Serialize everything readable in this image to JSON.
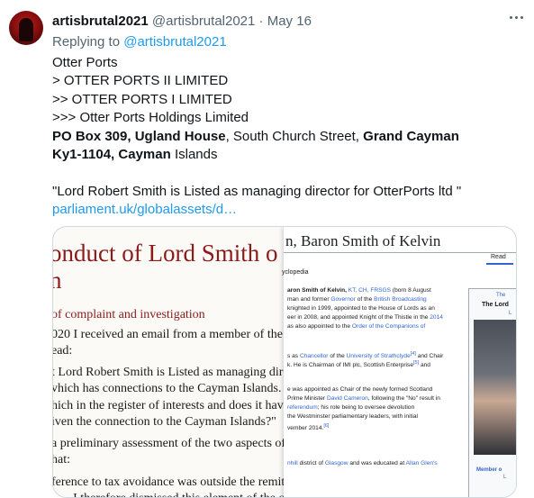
{
  "tweet": {
    "display_name": "artisbrutal2021",
    "handle": "@artisbrutal2021",
    "separator": "·",
    "date": "May 16",
    "replying_prefix": "Replying to",
    "replying_handle": "@artisbrutal2021",
    "lines": {
      "l1": "Otter Ports",
      "l2": "> OTTER PORTS II LIMITED",
      "l3": ">> OTTER PORTS I LIMITED",
      "l4": ">>> Otter Ports Holdings Limited",
      "l5a": "PO Box 309,",
      "l5b": "Ugland House",
      "l5c": ", South Church Street,",
      "l5d": "Grand Cayman",
      "l6a": "Ky1-1104,",
      "l6b": "Cayman",
      "l6c": "Islands",
      "quote": "\"Lord Robert Smith is Listed as managing director for OtterPorts ltd \"",
      "link": "parliament.uk/globalassets/d…"
    }
  },
  "media": {
    "paper": {
      "title_line1": "onduct of Lord Smith o",
      "title_line2": "n",
      "section": "of complaint and investigation",
      "p1": "020 I received an email from a member of the public",
      "p2": "ead:",
      "p3": "t Lord Robert Smith is Listed as managing direct",
      "p4": "vhich has connections to the Cayman Islands.",
      "p5": "hich in the register of interests and does it have any ta",
      "p6": "iven the connection to the Cayman Islands?\"",
      "p7": "a preliminary assessment of the two aspects of th",
      "p8": "hat:",
      "p9": "ference to tax avoidance was outside the remit o",
      "p10": "ct—I therefore dismissed this element of the com"
    },
    "wiki": {
      "title": "n, Baron Smith of Kelvin",
      "read": "Read",
      "encyclopedia": "yclopedia",
      "l1a": "aron Smith of Kelvin,",
      "l1b": "KT, CH, FRSGS",
      "l1c": "(born 8 August",
      "l2a": "man and former",
      "l2b": "Governor",
      "l2c": "of the",
      "l2d": "British Broadcasting",
      "l3": "knighted in 1999, appointed to the House of Lords as an",
      "l4a": "eer in 2008, and appointed Knight of the Thistle in the",
      "l4b": "2014",
      "l5a": "as also appointed to the",
      "l5b": "Order of the Companions of",
      "l6a": "s as",
      "l6b": "Chancellor",
      "l6c": "of the",
      "l6d": "University of Strathclyde",
      "l6e": "[4]",
      "l6f": "and Chair",
      "l7a": "k. He is Chairman of IMI plc, Scottish Enterprise",
      "l7b": "[5]",
      "l7c": "and",
      "l8": "e was appointed as Chair of the newly formed Scotland",
      "l9a": "Prime Minister",
      "l9b": "David Cameron",
      "l9c": ", following the \"No\" result in",
      "l10a": "referendum",
      "l10b": "; his role being to oversee devolution",
      "l11": "the Westminster parliamentary leaders, with initial",
      "l12a": "vember 2014.",
      "l12b": "[6]",
      "l13a": "nhill",
      "l13b": "district of",
      "l13c": "Glasgow",
      "l13d": "and was educated at",
      "l13e": "Allan Glen's",
      "info_t1": "The",
      "info_t2": "The Lord",
      "info_t3": "L",
      "info_cap": "Member o",
      "info_cap2": "L"
    }
  }
}
